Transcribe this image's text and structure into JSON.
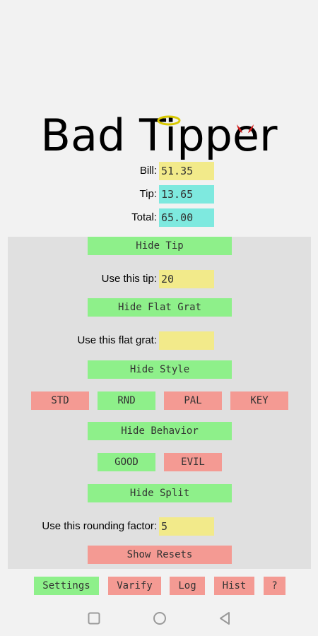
{
  "app": {
    "title": "Bad Tipper"
  },
  "summary": {
    "bill_label": "Bill:",
    "bill_value": "51.35",
    "tip_label": "Tip:",
    "tip_value": "13.65",
    "total_label": "Total:",
    "total_value": "65.00"
  },
  "panel": {
    "hide_tip": "Hide Tip",
    "use_tip_label": "Use this tip:",
    "use_tip_value": "20",
    "hide_flat_grat": "Hide Flat Grat",
    "flat_grat_label": "Use this flat grat:",
    "flat_grat_value": "",
    "hide_style": "Hide Style",
    "styles": [
      "STD",
      "RND",
      "PAL",
      "KEY"
    ],
    "hide_behavior": "Hide Behavior",
    "behaviors": [
      "GOOD",
      "EVIL"
    ],
    "hide_split": "Hide Split",
    "rounding_label": "Use this rounding factor:",
    "rounding_value": "5",
    "show_resets": "Show Resets"
  },
  "bottom": {
    "settings": "Settings",
    "varify": "Varify",
    "log": "Log",
    "hist": "Hist",
    "help": "?"
  },
  "colors": {
    "green": "#8ef08a",
    "red": "#f49a93",
    "yellow": "#f2ea8a",
    "cyan": "#7ee9df"
  },
  "icons": {
    "halo": "halo-icon",
    "horns": "devil-horns-icon",
    "nav_recent": "square-icon",
    "nav_home": "circle-icon",
    "nav_back": "triangle-back-icon"
  }
}
